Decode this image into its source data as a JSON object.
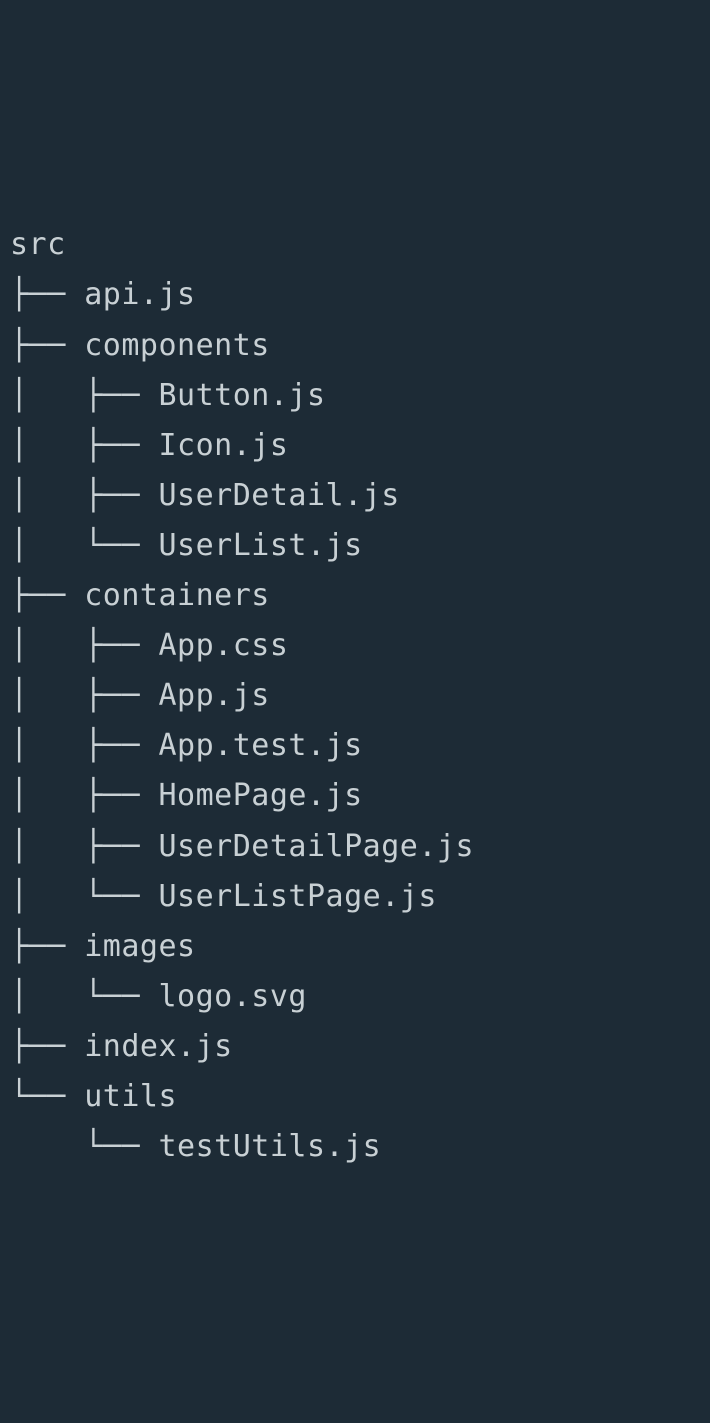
{
  "tree": {
    "lines": [
      "src",
      "├── api.js",
      "├── components",
      "│   ├── Button.js",
      "│   ├── Icon.js",
      "│   ├── UserDetail.js",
      "│   └── UserList.js",
      "├── containers",
      "│   ├── App.css",
      "│   ├── App.js",
      "│   ├── App.test.js",
      "│   ├── HomePage.js",
      "│   ├── UserDetailPage.js",
      "│   └── UserListPage.js",
      "├── images",
      "│   └── logo.svg",
      "├── index.js",
      "└── utils",
      "    └── testUtils.js"
    ]
  }
}
